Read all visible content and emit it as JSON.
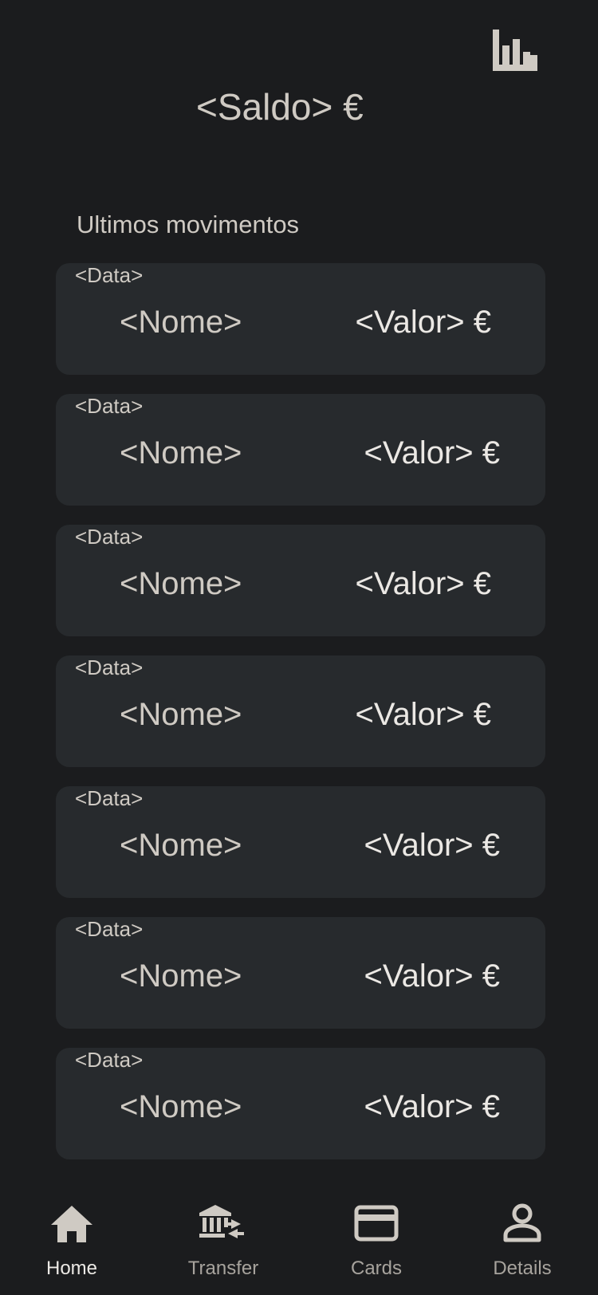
{
  "header": {
    "balance": "<Saldo> €",
    "stats_icon": "bar-chart-icon"
  },
  "movements": {
    "title": "Ultimos movimentos",
    "items": [
      {
        "date": "<Data>",
        "name": "<Nome>",
        "value": "<Valor> €"
      },
      {
        "date": "<Data>",
        "name": "<Nome>",
        "value": "<Valor> €"
      },
      {
        "date": "<Data>",
        "name": "<Nome>",
        "value": "<Valor> €"
      },
      {
        "date": "<Data>",
        "name": "<Nome>",
        "value": "<Valor> €"
      },
      {
        "date": "<Data>",
        "name": "<Nome>",
        "value": "<Valor> €"
      },
      {
        "date": "<Data>",
        "name": "<Nome>",
        "value": "<Valor> €"
      },
      {
        "date": "<Data>",
        "name": "<Nome>",
        "value": "<Valor> €"
      }
    ]
  },
  "nav": {
    "items": [
      {
        "label": "Home",
        "icon": "home-icon",
        "active": true
      },
      {
        "label": "Transfer",
        "icon": "bank-transfer-icon",
        "active": false
      },
      {
        "label": "Cards",
        "icon": "credit-card-icon",
        "active": false
      },
      {
        "label": "Details",
        "icon": "person-icon",
        "active": false
      }
    ]
  },
  "colors": {
    "background": "#1b1c1e",
    "card": "#272a2d",
    "text": "#cfcac3",
    "accent_text": "#ebe8e4"
  }
}
